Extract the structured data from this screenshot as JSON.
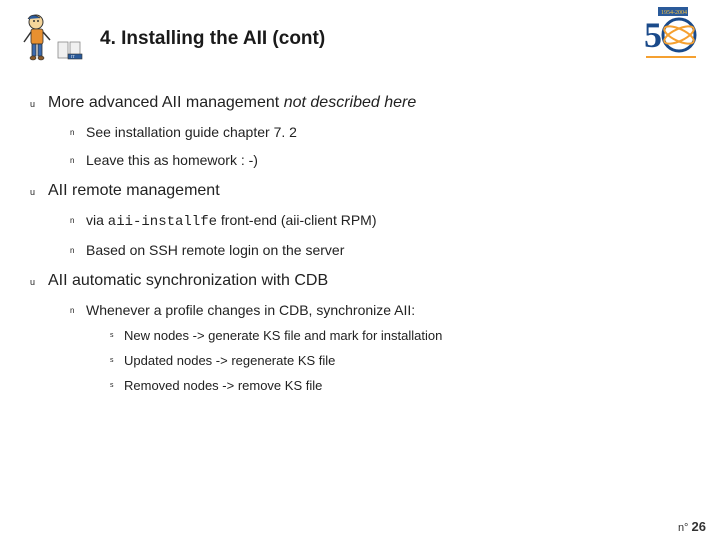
{
  "title": "4. Installing the AII (cont)",
  "logo_left_badge": "IT",
  "logo_right_top": "1954-2004",
  "logo_right_num": "5",
  "content": {
    "u1": {
      "text": "More advanced AII management ",
      "italic": "not described here",
      "n1": "See installation guide chapter 7. 2",
      "n2": "Leave this as homework : -)"
    },
    "u2": {
      "text": "AII remote management",
      "n1_pre": "via ",
      "n1_code": "aii-installfe",
      "n1_post": " front-end (aii-client RPM)",
      "n2": "Based on SSH remote login on the server"
    },
    "u3": {
      "text": "AII automatic synchronization with CDB",
      "n1": "Whenever a profile changes in CDB, synchronize AII:",
      "s1": "New nodes -> generate KS file and mark for installation",
      "s2": "Updated nodes -> regenerate KS file",
      "s3": "Removed nodes -> remove KS file"
    }
  },
  "footer_prefix": "n°",
  "footer_page": "26"
}
